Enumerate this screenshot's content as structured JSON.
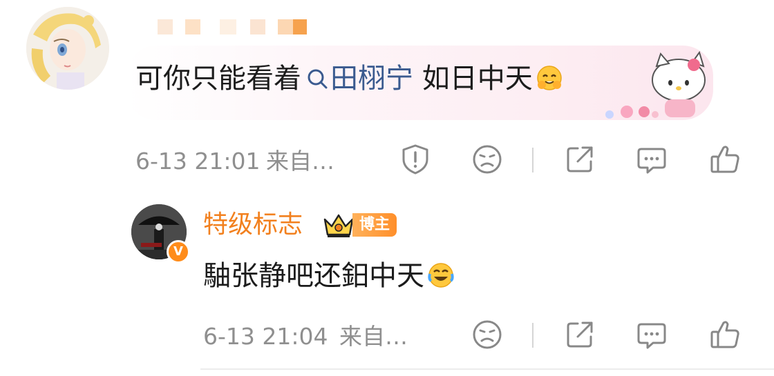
{
  "main_comment": {
    "text_before": "可你只能看着",
    "topic": "田栩宁",
    "text_after": " 如日中天",
    "timestamp": "6-13 21:01",
    "source": "来自…",
    "emoji": "hug-emoji"
  },
  "reply": {
    "username": "特级标志",
    "tag": "博主",
    "verify_badge": "V",
    "text": "駎张静吧还鈤中天",
    "timestamp": "6-13 21:04",
    "source": "来自…",
    "emoji": "laugh-cry-emoji"
  },
  "colors": {
    "username": "#f2801e",
    "topic": "#3a5a8f",
    "meta": "#8f8f8f"
  }
}
